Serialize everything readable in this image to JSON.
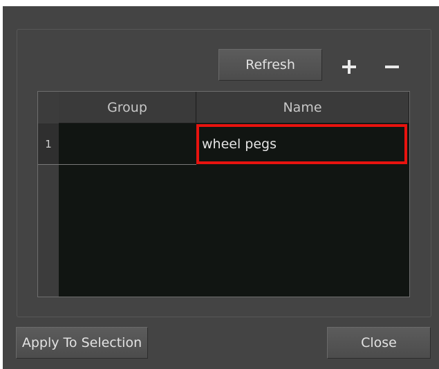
{
  "toolbar": {
    "refresh_label": "Refresh",
    "add_icon": "plus-icon",
    "remove_icon": "minus-icon"
  },
  "table": {
    "columns": [
      "Group",
      "Name"
    ],
    "rows": [
      {
        "index": "1",
        "group": "",
        "name": "wheel pegs"
      }
    ]
  },
  "footer": {
    "apply_label": "Apply To Selection",
    "close_label": "Close"
  },
  "colors": {
    "window_bg": "#444444",
    "table_bg": "#111512",
    "selection_outline": "#e8130f"
  }
}
